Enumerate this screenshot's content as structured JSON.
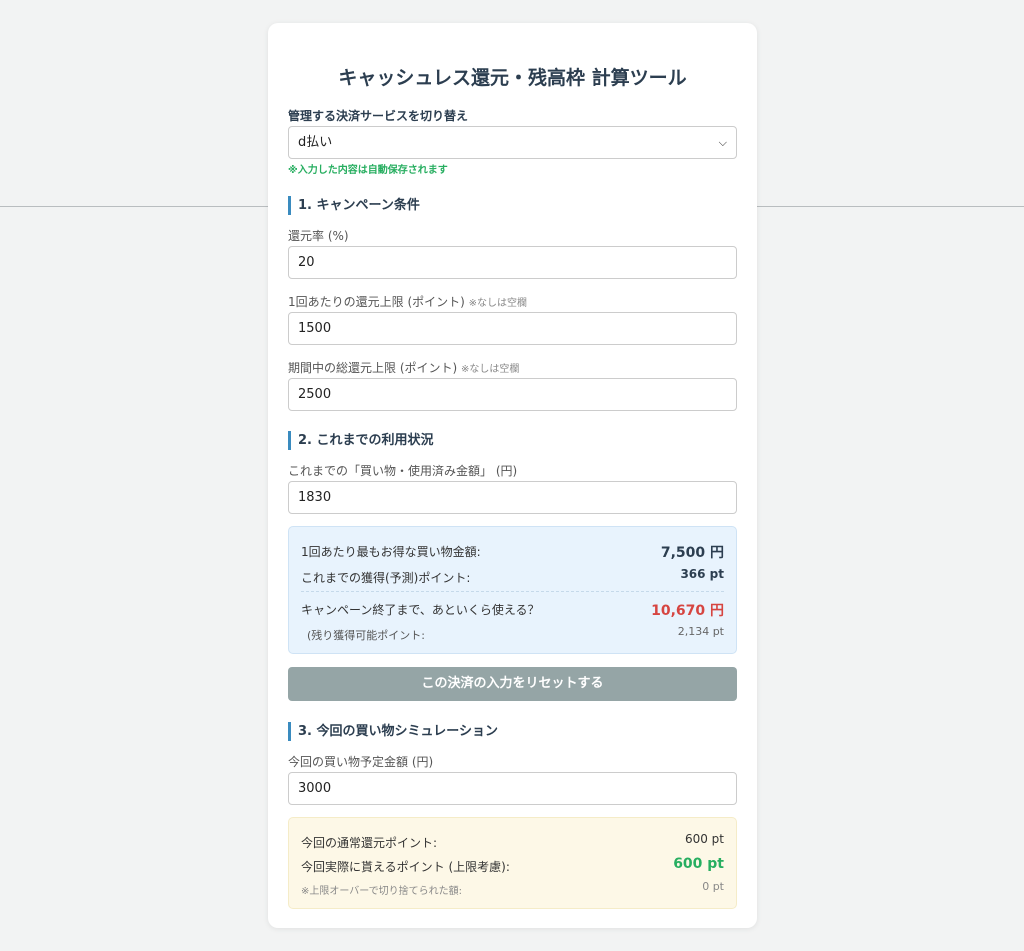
{
  "app": {
    "title": "キャッシュレス還元・残高枠 計算ツール",
    "service_label": "管理する決済サービスを切り替え",
    "service_selected": "d払い",
    "autosave_note": "※入力した内容は自動保存されます"
  },
  "campaign": {
    "heading": "1. キャンペーン条件",
    "rate_label": "還元率 (%)",
    "rate_value": "20",
    "per_use_label": "1回あたりの還元上限 (ポイント)",
    "per_use_note": "※なしは空欄",
    "per_use_value": "1500",
    "total_label": "期間中の総還元上限 (ポイント)",
    "total_note": "※なしは空欄",
    "total_value": "2500"
  },
  "usage": {
    "heading": "2. これまでの利用状況",
    "spent_label": "これまでの「買い物・使用済み金額」 (円)",
    "spent_value": "1830",
    "best_label": "1回あたり最もお得な買い物金額:",
    "best_value": "7,500 円",
    "earned_label": "これまでの獲得(予測)ポイント:",
    "earned_value": "366 pt",
    "remaining_label": "キャンペーン終了まで、あといくら使える？",
    "remaining_value": "10,670 円",
    "remaining_pts_label": "(残り獲得可能ポイント:",
    "remaining_pts_value": "2,134 pt",
    "reset_button": "この決済の入力をリセットする"
  },
  "simulation": {
    "heading": "3. 今回の買い物シミュレーション",
    "amount_label": "今回の買い物予定金額 (円)",
    "amount_value": "3000",
    "normal_label": "今回の通常還元ポイント:",
    "normal_value": "600 pt",
    "actual_label": "今回実際に貰えるポイント (上限考慮):",
    "actual_value": "600 pt",
    "cut_label": "※上限オーバーで切り捨てられた額:",
    "cut_value": "0 pt"
  },
  "colors": {
    "accent": "#3a8bbf",
    "success": "#27ae60",
    "danger": "#d64541",
    "reset_button": "#95a5a6"
  },
  "icons": {
    "select_arrow": "chevron-down-icon"
  }
}
